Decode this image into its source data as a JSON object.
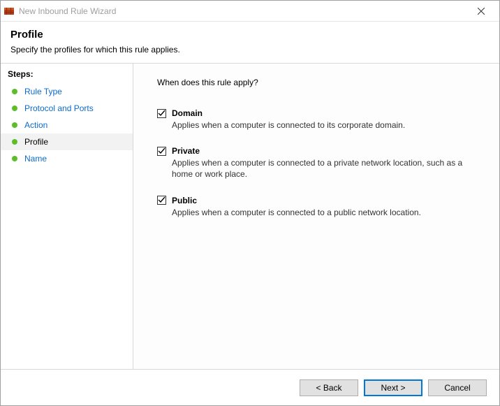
{
  "window": {
    "title": "New Inbound Rule Wizard"
  },
  "header": {
    "title": "Profile",
    "subtitle": "Specify the profiles for which this rule applies."
  },
  "sidebar": {
    "heading": "Steps:",
    "items": [
      {
        "label": "Rule Type"
      },
      {
        "label": "Protocol and Ports"
      },
      {
        "label": "Action"
      },
      {
        "label": "Profile"
      },
      {
        "label": "Name"
      }
    ],
    "current_index": 3
  },
  "content": {
    "question": "When does this rule apply?",
    "profiles": [
      {
        "name": "Domain",
        "desc": "Applies when a computer is connected to its corporate domain.",
        "checked": true
      },
      {
        "name": "Private",
        "desc": "Applies when a computer is connected to a private network location, such as a home or work place.",
        "checked": true
      },
      {
        "name": "Public",
        "desc": "Applies when a computer is connected to a public network location.",
        "checked": true
      }
    ]
  },
  "footer": {
    "back": "< Back",
    "next": "Next >",
    "cancel": "Cancel"
  }
}
